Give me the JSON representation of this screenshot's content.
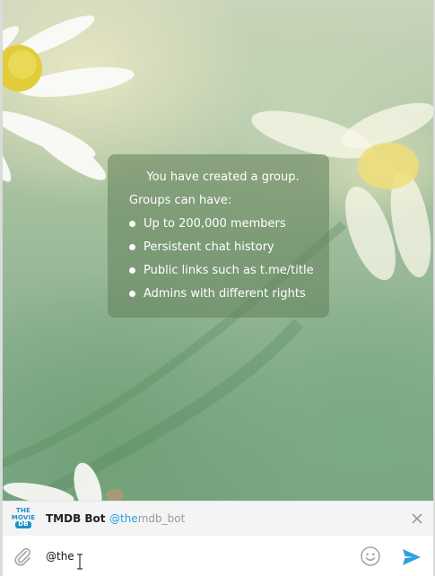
{
  "service_message": {
    "title": "You have created a group.",
    "subtitle": "Groups can have:",
    "features": [
      "Up to 200,000 members",
      "Persistent chat history",
      "Public links such as t.me/title",
      "Admins with different rights"
    ]
  },
  "mention_suggestion": {
    "avatar_lines": [
      "THE",
      "MOVIE",
      "DB"
    ],
    "name": "TMDB Bot",
    "username_match": "@the",
    "username_rest": "mdb_bot",
    "close_icon": "close-icon"
  },
  "composer": {
    "input_value": "@the",
    "attach_icon": "paperclip-icon",
    "emoji_icon": "smiley-icon",
    "send_icon": "send-icon"
  },
  "colors": {
    "accent": "#2ea0e0",
    "bubble_bg": "#62805a",
    "bar_bg": "#f4f4f4"
  }
}
